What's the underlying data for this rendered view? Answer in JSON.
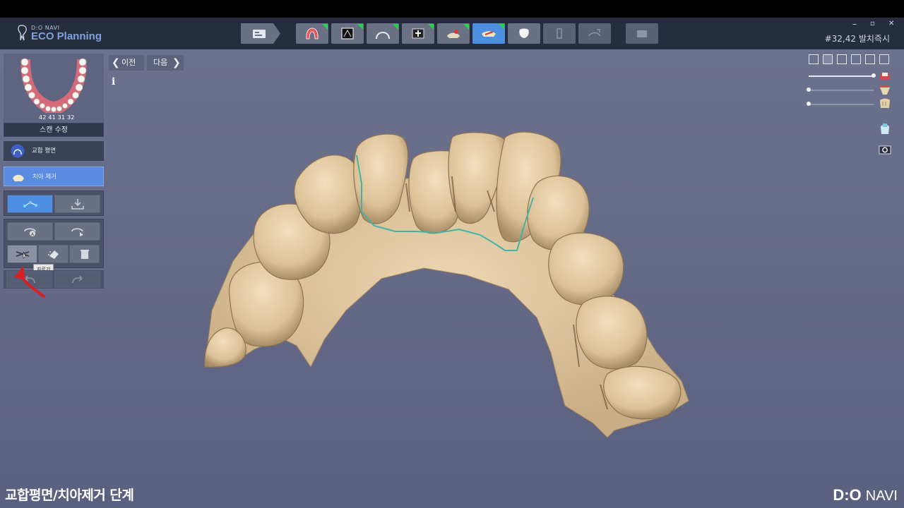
{
  "app": {
    "logo_top": "D:O NAVI",
    "logo_main": "ECO Planning",
    "case_title": "#32,42 발치즉시",
    "window_controls": {
      "minimize": "–",
      "maximize": "▫",
      "close": "✕"
    }
  },
  "toolbar": {
    "steps": [
      {
        "icon": "patient-info-icon",
        "state": "normal",
        "done": false
      },
      {
        "icon": "scan-arch-icon",
        "state": "normal",
        "done": true
      },
      {
        "icon": "ct-scan-icon",
        "state": "normal",
        "done": true
      },
      {
        "icon": "arch-curve-icon",
        "state": "normal",
        "done": true
      },
      {
        "icon": "implant-plan-icon",
        "state": "normal",
        "done": true
      },
      {
        "icon": "guide-design-icon",
        "state": "normal",
        "done": true
      },
      {
        "icon": "tooth-removal-icon",
        "state": "active",
        "done": true
      },
      {
        "icon": "crown-icon",
        "state": "normal",
        "done": false
      },
      {
        "icon": "sleeve-icon",
        "state": "disabled",
        "done": false
      },
      {
        "icon": "guide-export-icon",
        "state": "disabled",
        "done": false
      },
      {
        "icon": "output-icon",
        "state": "disabled",
        "done": false
      }
    ]
  },
  "sidebar": {
    "tooth_numbers": "42 41 31 32",
    "scan_edit": "스캔 수정",
    "occlusal_plane": "교합 평면",
    "tooth_removal": "치아 제거",
    "tooltip": "자르기"
  },
  "nav": {
    "prev": "이전",
    "next": "다음",
    "info": "i"
  },
  "right_panel": {
    "sliders": [
      {
        "name": "gum-opacity",
        "value": 1.0
      },
      {
        "name": "scan-opacity",
        "value": 0.0
      },
      {
        "name": "tooth-opacity",
        "value": 0.0
      }
    ]
  },
  "caption": "교합평면/치아제거 단계",
  "brand": {
    "mark": "D:O",
    "name": "NAVI"
  },
  "colors": {
    "active": "#4f8fe4",
    "done_flag": "#27d24b",
    "model": "#e3caa0",
    "margin_line": "#43b3a6",
    "annotation": "#d5202a"
  }
}
